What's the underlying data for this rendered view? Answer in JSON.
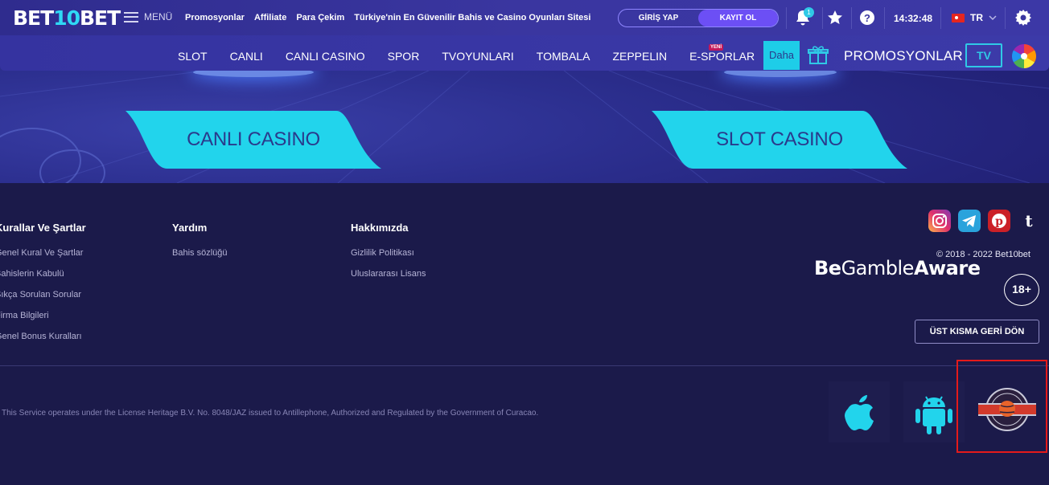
{
  "header": {
    "logo_pre": "BET",
    "logo_mid": "10",
    "logo_post": "BET",
    "menu_label": "MENÜ",
    "top_links": [
      "Promosyonlar",
      "Affiliate",
      "Para Çekim",
      "Türkiye'nin En Güvenilir Bahis ve Casino Oyunları Sitesi"
    ],
    "login_label": "GİRİŞ YAP",
    "register_label": "KAYIT OL",
    "notification_count": "1",
    "clock": "14:32:48",
    "language": "TR"
  },
  "nav": {
    "items": [
      "SLOT",
      "CANLI",
      "CANLI CASINO",
      "SPOR",
      "TVOYUNLARI",
      "TOMBALA",
      "ZEPPELIN",
      "E-SPORLAR"
    ],
    "new_badge": "YENİ",
    "more_label": "Daha",
    "promotions_label": "PROMOSYONLAR",
    "tv_label": "TV"
  },
  "hero": {
    "left_button": "CANLI CASINO",
    "right_button": "SLOT CASINO"
  },
  "footer": {
    "columns": [
      {
        "title": "Kurallar Ve Şartlar",
        "links": [
          "Genel Kural Ve Şartlar",
          "Bahislerin Kabulü",
          "Sıkça Sorulan Sorular",
          "Firma Bilgileri",
          "Genel Bonus Kuralları"
        ]
      },
      {
        "title": "Yardım",
        "links": [
          "Bahis sözlüğü"
        ]
      },
      {
        "title": "Hakkımızda",
        "links": [
          "Gizlilik Politikası",
          "Uluslararası Lisans"
        ]
      }
    ],
    "copyright": "© 2018 - 2022 Bet10bet",
    "gamble_bold_1": "Be",
    "gamble_regular": "Gamble",
    "gamble_bold_2": "Aware",
    "age_badge": "18+",
    "back_to_top": "ÜST KISMA GERİ DÖN",
    "license_text": "This Service operates under the License Heritage B.V. No. 8048/JAZ issued to Antillephone, Authorized and Regulated by the Government of Curacao."
  },
  "colors": {
    "accent_cyan": "#1ecde8",
    "register_purple": "#6c4ff5",
    "highlight_red": "#e51a1a"
  },
  "icons": [
    "hamburger-icon",
    "bell-icon",
    "star-icon",
    "help-icon",
    "settings-icon",
    "chevron-down-icon",
    "gift-icon",
    "wheel-icon",
    "instagram-icon",
    "telegram-icon",
    "pinterest-icon",
    "tumblr-icon",
    "apple-icon",
    "android-icon",
    "antillephone-seal-icon"
  ]
}
